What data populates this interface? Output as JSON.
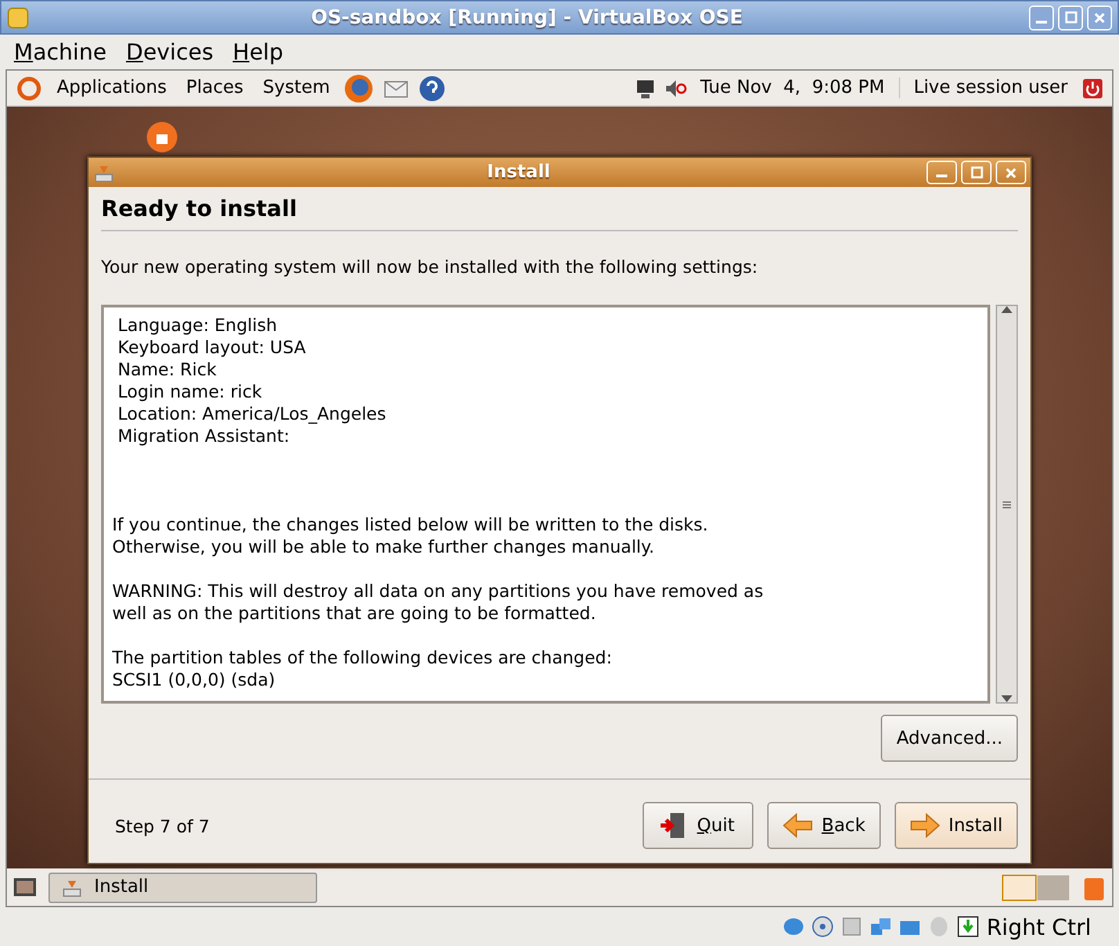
{
  "window": {
    "title": "OS-sandbox [Running] - VirtualBox OSE"
  },
  "menu": [
    {
      "mnemonic": "M",
      "rest": "achine"
    },
    {
      "mnemonic": "D",
      "rest": "evices"
    },
    {
      "mnemonic": "H",
      "rest": "elp"
    }
  ],
  "top_panel": {
    "menus": [
      "Applications",
      "Places",
      "System"
    ],
    "clock": "Tue Nov  4,  9:08 PM",
    "user": "Live session user"
  },
  "dialog": {
    "title": "Install",
    "heading": "Ready to install",
    "intro": "Your new operating system will now be installed with the following settings:",
    "settings": [
      "Language: English",
      "Keyboard layout: USA",
      "Name: Rick",
      "Login name: rick",
      "Location: America/Los_Angeles",
      "Migration Assistant:"
    ],
    "paragraphs": [
      [
        "If you continue, the changes listed below will be written to the disks.",
        "Otherwise, you will be able to make further changes manually."
      ],
      [
        "WARNING: This will destroy all data on any partitions you have removed as",
        "well as on the partitions that are going to be formatted."
      ],
      [
        "The partition tables of the following devices are changed:",
        "SCSI1 (0,0,0) (sda)"
      ]
    ],
    "advanced": "Advanced...",
    "step": "Step 7 of 7",
    "buttons": [
      {
        "kind": "quit",
        "mnemonic": "Q",
        "rest": "uit",
        "selected": false
      },
      {
        "kind": "back",
        "mnemonic": "B",
        "rest": "ack",
        "selected": false
      },
      {
        "kind": "install",
        "rest": "Install",
        "selected": true
      }
    ]
  },
  "taskbar": {
    "items": [
      {
        "label": "Install"
      }
    ]
  },
  "status_bar": {
    "host_key": "Right Ctrl"
  }
}
